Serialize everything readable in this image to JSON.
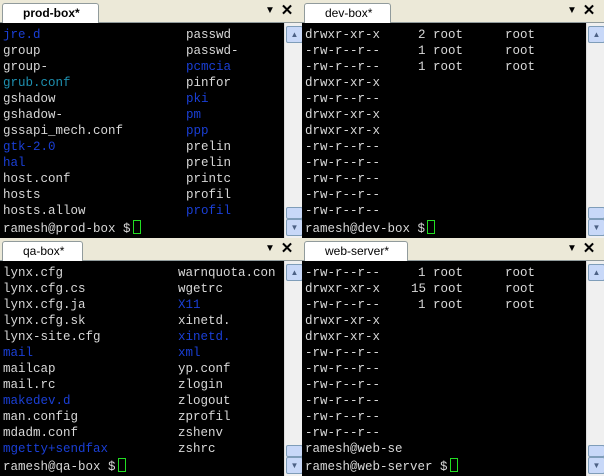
{
  "controls": {
    "menu_glyph": "▼",
    "close_glyph": "✕",
    "scroll_up_glyph": "▲",
    "scroll_down_glyph": "▼"
  },
  "panes": [
    {
      "tab": "prod-box*",
      "rows": [
        [
          "jre.d",
          "passwd"
        ],
        [
          "group",
          "passwd-"
        ],
        [
          "group-",
          "pcmcia"
        ],
        [
          "grub.conf",
          "pinfor"
        ],
        [
          "gshadow",
          "pki"
        ],
        [
          "gshadow-",
          "pm"
        ],
        [
          "gssapi_mech.conf",
          "ppp"
        ],
        [
          "gtk-2.0",
          "prelin"
        ],
        [
          "hal",
          "prelin"
        ],
        [
          "host.conf",
          "printc"
        ],
        [
          "hosts",
          "profil"
        ],
        [
          "hosts.allow",
          "profil"
        ]
      ],
      "prompt": "ramesh@prod-box $"
    },
    {
      "tab": "dev-box*",
      "rows": [
        [
          "drwxr-xr-x",
          "2",
          "root",
          "root"
        ],
        [
          "-rw-r--r--",
          "1",
          "root",
          "root"
        ],
        [
          "-rw-r--r--",
          "1",
          "root",
          "root"
        ],
        [
          "drwxr-xr-x",
          "",
          "",
          ""
        ],
        [
          "-rw-r--r--",
          "",
          "",
          ""
        ],
        [
          "drwxr-xr-x",
          "",
          "",
          ""
        ],
        [
          "drwxr-xr-x",
          "",
          "",
          ""
        ],
        [
          "-rw-r--r--",
          "",
          "",
          ""
        ],
        [
          "-rw-r--r--",
          "",
          "",
          ""
        ],
        [
          "-rw-r--r--",
          "",
          "",
          ""
        ],
        [
          "-rw-r--r--",
          "",
          "",
          ""
        ],
        [
          "-rw-r--r--",
          "",
          "",
          ""
        ]
      ],
      "prompt": "ramesh@dev-box $"
    },
    {
      "tab": "qa-box*",
      "rows": [
        [
          "lynx.cfg",
          "warnquota.con"
        ],
        [
          "lynx.cfg.cs",
          "wgetrc"
        ],
        [
          "lynx.cfg.ja",
          "X11"
        ],
        [
          "lynx.cfg.sk",
          "xinetd."
        ],
        [
          "lynx-site.cfg",
          "xinetd."
        ],
        [
          "mail",
          "xml"
        ],
        [
          "mailcap",
          "yp.conf"
        ],
        [
          "mail.rc",
          "zlogin"
        ],
        [
          "makedev.d",
          "zlogout"
        ],
        [
          "man.config",
          "zprofil"
        ],
        [
          "mdadm.conf",
          "zshenv"
        ],
        [
          "mgetty+sendfax",
          "zshrc"
        ]
      ],
      "prompt": "ramesh@qa-box $"
    },
    {
      "tab": "web-server*",
      "rows": [
        [
          "-rw-r--r--",
          "1",
          "root",
          "root"
        ],
        [
          "drwxr-xr-x",
          "15",
          "root",
          "root"
        ],
        [
          "-rw-r--r--",
          "1",
          "root",
          "root"
        ],
        [
          "drwxr-xr-x",
          "",
          "",
          ""
        ],
        [
          "drwxr-xr-x",
          "",
          "",
          ""
        ],
        [
          "-rw-r--r--",
          "",
          "",
          ""
        ],
        [
          "-rw-r--r--",
          "",
          "",
          ""
        ],
        [
          "-rw-r--r--",
          "",
          "",
          ""
        ],
        [
          "-rw-r--r--",
          "",
          "",
          ""
        ],
        [
          "-rw-r--r--",
          "",
          "",
          ""
        ],
        [
          "-rw-r--r--",
          "",
          "",
          ""
        ],
        [
          "ramesh@web-se",
          "",
          "",
          ""
        ]
      ],
      "prompt": "ramesh@web-server $"
    }
  ]
}
